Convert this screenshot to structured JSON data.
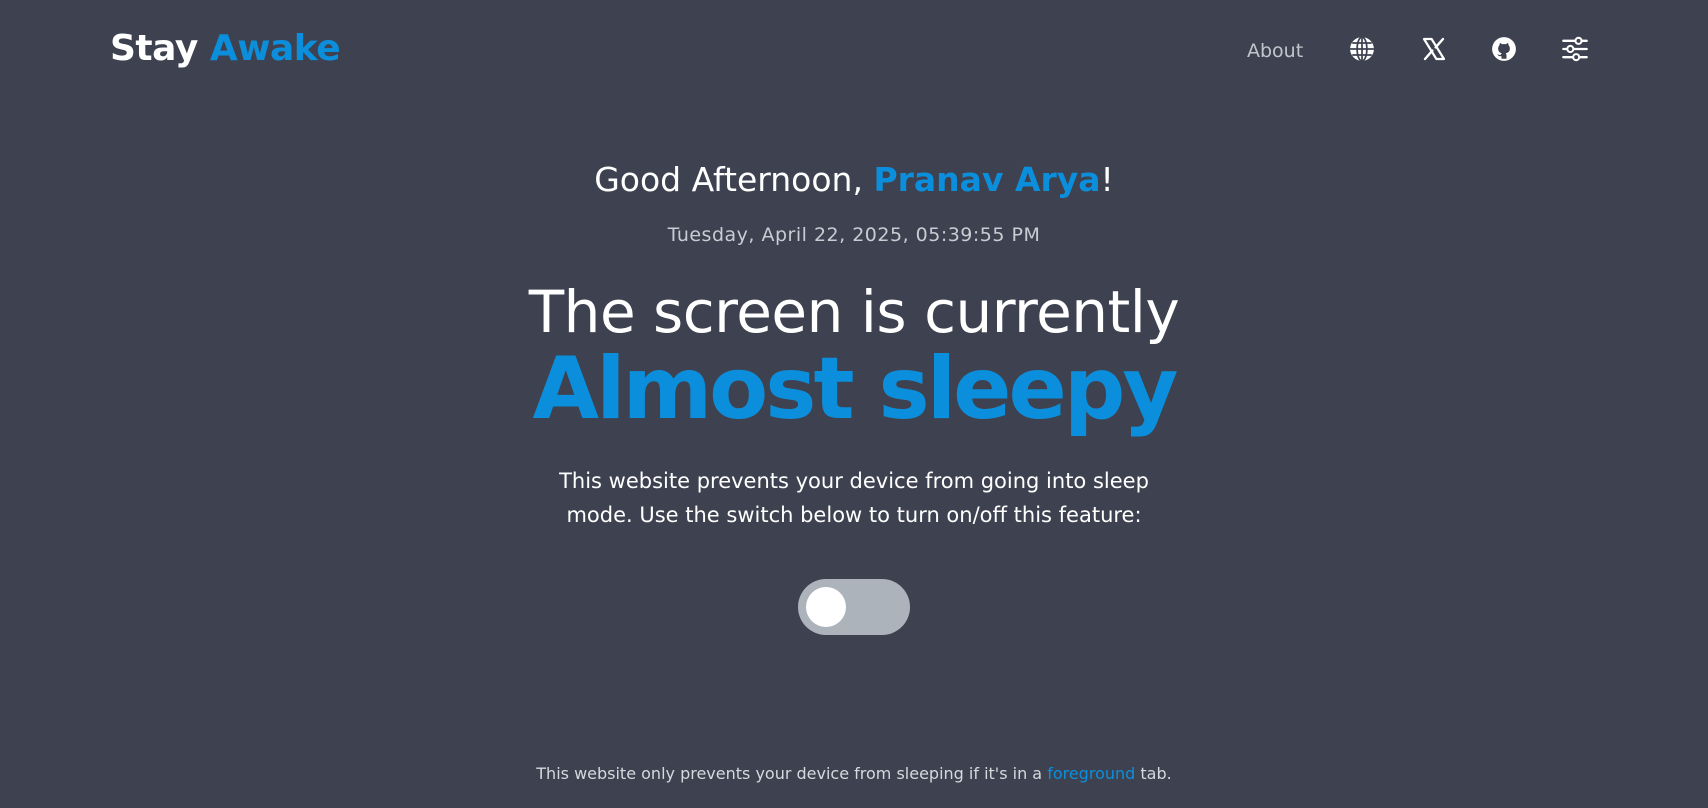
{
  "header": {
    "logo_part1": "Stay",
    "logo_part2": "Awake",
    "nav": {
      "about_label": "About",
      "icons": [
        "globe-icon",
        "x-icon",
        "github-icon",
        "settings-sliders-icon"
      ]
    }
  },
  "main": {
    "greeting_prefix": "Good Afternoon, ",
    "greeting_name": "Pranav Arya",
    "greeting_suffix": "!",
    "datetime": "Tuesday, April 22, 2025, 05:39:55 PM",
    "headline": "The screen is currently",
    "status": "Almost sleepy",
    "description": "This website prevents your device from going into sleep mode. Use the switch below to turn on/off this feature:",
    "toggle_state": "off"
  },
  "footer": {
    "text_before": "This website only prevents your device from sleeping if it's in a ",
    "link_text": "foreground",
    "text_after": " tab."
  },
  "colors": {
    "background": "#3e4250",
    "accent": "#0b8fdc",
    "toggle_track": "#adb3bb",
    "toggle_knob": "#ffffff"
  }
}
